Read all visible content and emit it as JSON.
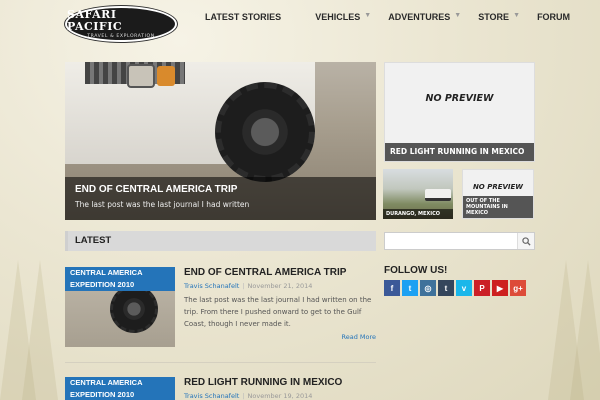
{
  "site": {
    "logo_name": "SAFARI PACIFIC",
    "logo_tagline": "TRAVEL & EXPLORATION"
  },
  "nav": {
    "items": [
      {
        "label": "LATEST STORIES",
        "has_dropdown": false
      },
      {
        "label": "VEHICLES",
        "has_dropdown": true
      },
      {
        "label": "ADVENTURES",
        "has_dropdown": true
      },
      {
        "label": "STORE",
        "has_dropdown": true
      },
      {
        "label": "FORUM",
        "has_dropdown": false
      }
    ]
  },
  "featured": {
    "main": {
      "title": "END OF CENTRAL AMERICA TRIP",
      "excerpt": "The last post was the last journal I had written"
    },
    "side_main": {
      "placeholder": "NO PREVIEW",
      "title": "RED LIGHT RUNNING IN MEXICO"
    },
    "side_thumb1": {
      "caption": "DURANGO, MEXICO"
    },
    "side_thumb2": {
      "placeholder": "NO PREVIEW",
      "caption": "OUT OF THE MOUNTAINS IN MEXICO"
    }
  },
  "latest": {
    "heading": "LATEST",
    "posts": [
      {
        "category": "CENTRAL AMERICA EXPEDITION 2010",
        "title": "END OF CENTRAL AMERICA TRIP",
        "author": "Travis Schanafelt",
        "date": "November 21, 2014",
        "excerpt": "The last post was the last journal I had written on the trip. From there I pushed onward to get to the Gulf Coast, though I never made it.",
        "read_more": "Read More"
      },
      {
        "category": "CENTRAL AMERICA EXPEDITION 2010",
        "title": "RED LIGHT RUNNING IN MEXICO",
        "author": "Travis Schanafelt",
        "date": "November 19, 2014"
      }
    ]
  },
  "sidebar": {
    "search_placeholder": "",
    "follow_title": "FOLLOW US!",
    "social": [
      {
        "name": "facebook-icon",
        "glyph": "f",
        "color": "#3b5998"
      },
      {
        "name": "twitter-icon",
        "glyph": "t",
        "color": "#1da1f2"
      },
      {
        "name": "instagram-icon",
        "glyph": "◎",
        "color": "#3f729b"
      },
      {
        "name": "tumblr-icon",
        "glyph": "t",
        "color": "#35465c"
      },
      {
        "name": "vimeo-icon",
        "glyph": "v",
        "color": "#1ab7ea"
      },
      {
        "name": "pinterest-icon",
        "glyph": "P",
        "color": "#cb2027"
      },
      {
        "name": "youtube-icon",
        "glyph": "▶",
        "color": "#cd201f"
      },
      {
        "name": "googleplus-icon",
        "glyph": "g+",
        "color": "#dd4b39"
      }
    ]
  }
}
